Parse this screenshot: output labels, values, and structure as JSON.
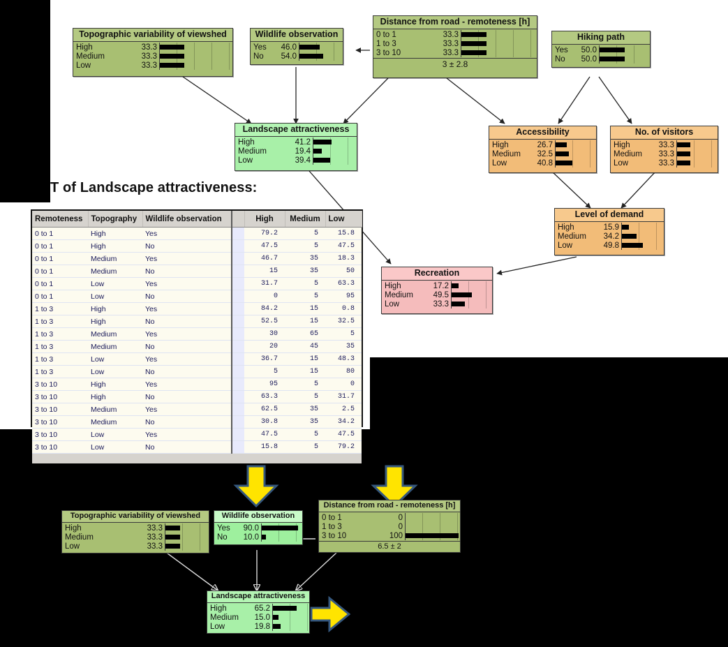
{
  "caption": "T of Landscape attractiveness:",
  "colors": {
    "node_green_dark": "#a8bf72",
    "node_green_light": "#a8f0a8",
    "node_orange": "#f2bc78",
    "node_pink": "#f5bcbc",
    "arrow_yellow": "#ffe400",
    "arrow_outline": "#35577d",
    "bar_black": "#000000"
  },
  "top_network": {
    "nodes": [
      {
        "id": "topographic-variability",
        "title": "Topographic variability of viewshed",
        "rows": [
          {
            "label": "High",
            "value": "33.3",
            "pct": 33.3
          },
          {
            "label": "Medium",
            "value": "33.3",
            "pct": 33.3
          },
          {
            "label": "Low",
            "value": "33.3",
            "pct": 33.3
          }
        ]
      },
      {
        "id": "wildlife-observation",
        "title": "Wildlife observation",
        "rows": [
          {
            "label": "Yes",
            "value": "46.0",
            "pct": 46.0
          },
          {
            "label": "No",
            "value": "54.0",
            "pct": 54.0
          }
        ]
      },
      {
        "id": "distance-from-road",
        "title": "Distance from road - remoteness [h]",
        "rows": [
          {
            "label": "0 to 1",
            "value": "33.3",
            "pct": 33.3
          },
          {
            "label": "1 to 3",
            "value": "33.3",
            "pct": 33.3
          },
          {
            "label": "3 to 10",
            "value": "33.3",
            "pct": 33.3
          }
        ],
        "mean": "3 ± 2.8"
      },
      {
        "id": "hiking-path",
        "title": "Hiking path",
        "rows": [
          {
            "label": "Yes",
            "value": "50.0",
            "pct": 50.0
          },
          {
            "label": "No",
            "value": "50.0",
            "pct": 50.0
          }
        ]
      },
      {
        "id": "landscape-attractiveness",
        "title": "Landscape attractiveness",
        "rows": [
          {
            "label": "High",
            "value": "41.2",
            "pct": 41.2
          },
          {
            "label": "Medium",
            "value": "19.4",
            "pct": 19.4
          },
          {
            "label": "Low",
            "value": "39.4",
            "pct": 39.4
          }
        ]
      },
      {
        "id": "accessibility",
        "title": "Accessibility",
        "rows": [
          {
            "label": "High",
            "value": "26.7",
            "pct": 26.7
          },
          {
            "label": "Medium",
            "value": "32.5",
            "pct": 32.5
          },
          {
            "label": "Low",
            "value": "40.8",
            "pct": 40.8
          }
        ]
      },
      {
        "id": "no-of-visitors",
        "title": "No. of visitors",
        "rows": [
          {
            "label": "High",
            "value": "33.3",
            "pct": 33.3
          },
          {
            "label": "Medium",
            "value": "33.3",
            "pct": 33.3
          },
          {
            "label": "Low",
            "value": "33.3",
            "pct": 33.3
          }
        ]
      },
      {
        "id": "level-of-demand",
        "title": "Level of demand",
        "rows": [
          {
            "label": "High",
            "value": "15.9",
            "pct": 15.9
          },
          {
            "label": "Medium",
            "value": "34.2",
            "pct": 34.2
          },
          {
            "label": "Low",
            "value": "49.8",
            "pct": 49.8
          }
        ]
      },
      {
        "id": "recreation",
        "title": "Recreation",
        "rows": [
          {
            "label": "High",
            "value": "17.2",
            "pct": 17.2
          },
          {
            "label": "Medium",
            "value": "49.5",
            "pct": 49.5
          },
          {
            "label": "Low",
            "value": "33.3",
            "pct": 33.3
          }
        ]
      }
    ]
  },
  "bottom_network": {
    "nodes": [
      {
        "id": "topographic-variability-2",
        "title": "Topographic variability of viewshed",
        "rows": [
          {
            "label": "High",
            "value": "33.3",
            "pct": 33.3
          },
          {
            "label": "Medium",
            "value": "33.3",
            "pct": 33.3
          },
          {
            "label": "Low",
            "value": "33.3",
            "pct": 33.3
          }
        ]
      },
      {
        "id": "wildlife-observation-2",
        "title": "Wildlife observation",
        "rows": [
          {
            "label": "Yes",
            "value": "90.0",
            "pct": 90.0
          },
          {
            "label": "No",
            "value": "10.0",
            "pct": 10.0
          }
        ]
      },
      {
        "id": "distance-from-road-2",
        "title": "Distance from road - remoteness [h]",
        "rows": [
          {
            "label": "0 to 1",
            "value": "0",
            "pct": 0
          },
          {
            "label": "1 to 3",
            "value": "0",
            "pct": 0
          },
          {
            "label": "3 to 10",
            "value": "100",
            "pct": 100
          }
        ],
        "mean": "6.5 ± 2"
      },
      {
        "id": "landscape-attractiveness-2",
        "title": "Landscape attractiveness",
        "rows": [
          {
            "label": "High",
            "value": "65.2",
            "pct": 65.2
          },
          {
            "label": "Medium",
            "value": "15.0",
            "pct": 15.0
          },
          {
            "label": "Low",
            "value": "19.8",
            "pct": 19.8
          }
        ]
      }
    ]
  },
  "cpt": {
    "headers": [
      "Remoteness",
      "Topography",
      "Wildlife observation",
      "High",
      "Medium",
      "Low"
    ],
    "rows": [
      [
        "0 to 1",
        "High",
        "Yes",
        "79.2",
        "5",
        "15.8"
      ],
      [
        "0 to 1",
        "High",
        "No",
        "47.5",
        "5",
        "47.5"
      ],
      [
        "0 to 1",
        "Medium",
        "Yes",
        "46.7",
        "35",
        "18.3"
      ],
      [
        "0 to 1",
        "Medium",
        "No",
        "15",
        "35",
        "50"
      ],
      [
        "0 to 1",
        "Low",
        "Yes",
        "31.7",
        "5",
        "63.3"
      ],
      [
        "0 to 1",
        "Low",
        "No",
        "0",
        "5",
        "95"
      ],
      [
        "1 to 3",
        "High",
        "Yes",
        "84.2",
        "15",
        "0.8"
      ],
      [
        "1 to 3",
        "High",
        "No",
        "52.5",
        "15",
        "32.5"
      ],
      [
        "1 to 3",
        "Medium",
        "Yes",
        "30",
        "65",
        "5"
      ],
      [
        "1 to 3",
        "Medium",
        "No",
        "20",
        "45",
        "35"
      ],
      [
        "1 to 3",
        "Low",
        "Yes",
        "36.7",
        "15",
        "48.3"
      ],
      [
        "1 to 3",
        "Low",
        "No",
        "5",
        "15",
        "80"
      ],
      [
        "3 to 10",
        "High",
        "Yes",
        "95",
        "5",
        "0"
      ],
      [
        "3 to 10",
        "High",
        "No",
        "63.3",
        "5",
        "31.7"
      ],
      [
        "3 to 10",
        "Medium",
        "Yes",
        "62.5",
        "35",
        "2.5"
      ],
      [
        "3 to 10",
        "Medium",
        "No",
        "30.8",
        "35",
        "34.2"
      ],
      [
        "3 to 10",
        "Low",
        "Yes",
        "47.5",
        "5",
        "47.5"
      ],
      [
        "3 to 10",
        "Low",
        "No",
        "15.8",
        "5",
        "79.2"
      ]
    ]
  }
}
